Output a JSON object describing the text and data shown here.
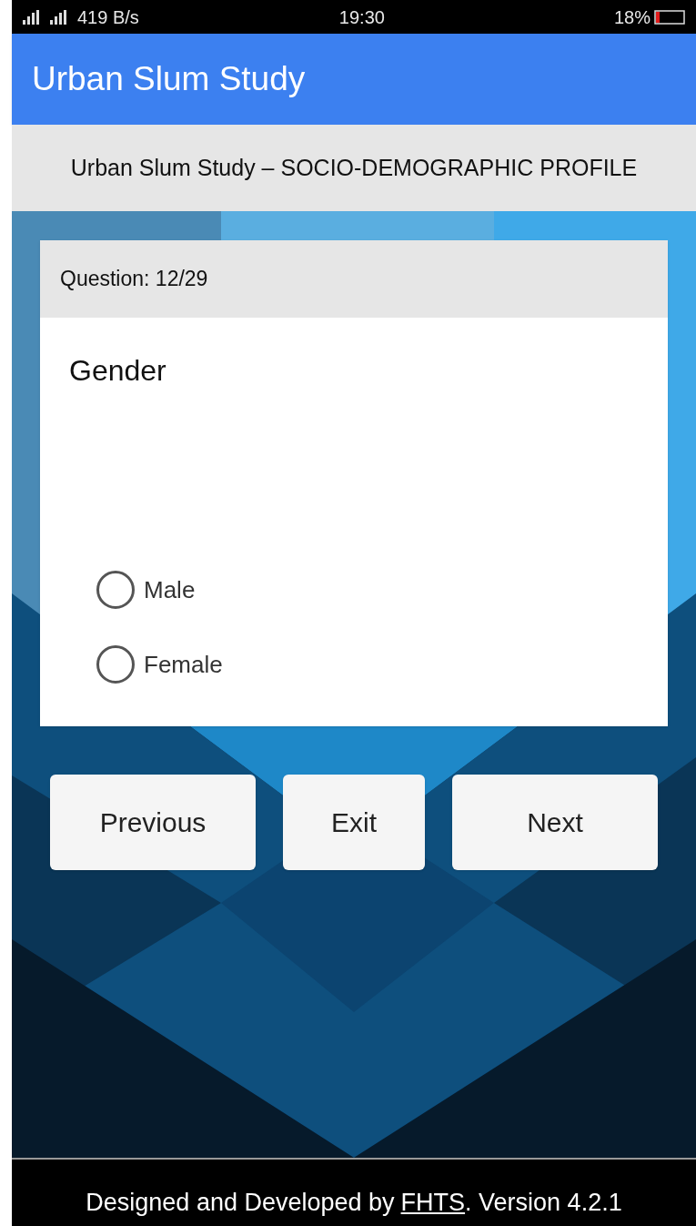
{
  "status_bar": {
    "network_speed": "419 B/s",
    "time": "19:30",
    "battery": "18%"
  },
  "app_bar": {
    "title": "Urban Slum Study"
  },
  "section_title": "Urban Slum Study – SOCIO-DEMOGRAPHIC PROFILE",
  "question": {
    "counter": "Question: 12/29",
    "text": "Gender",
    "options": [
      {
        "label": "Male",
        "selected": false
      },
      {
        "label": "Female",
        "selected": false
      }
    ]
  },
  "buttons": [
    "Previous",
    "Exit",
    "Next"
  ],
  "footer": {
    "before": "Designed and Developed by",
    "link": "FHTS",
    "after": ". Version 4.2.1"
  }
}
